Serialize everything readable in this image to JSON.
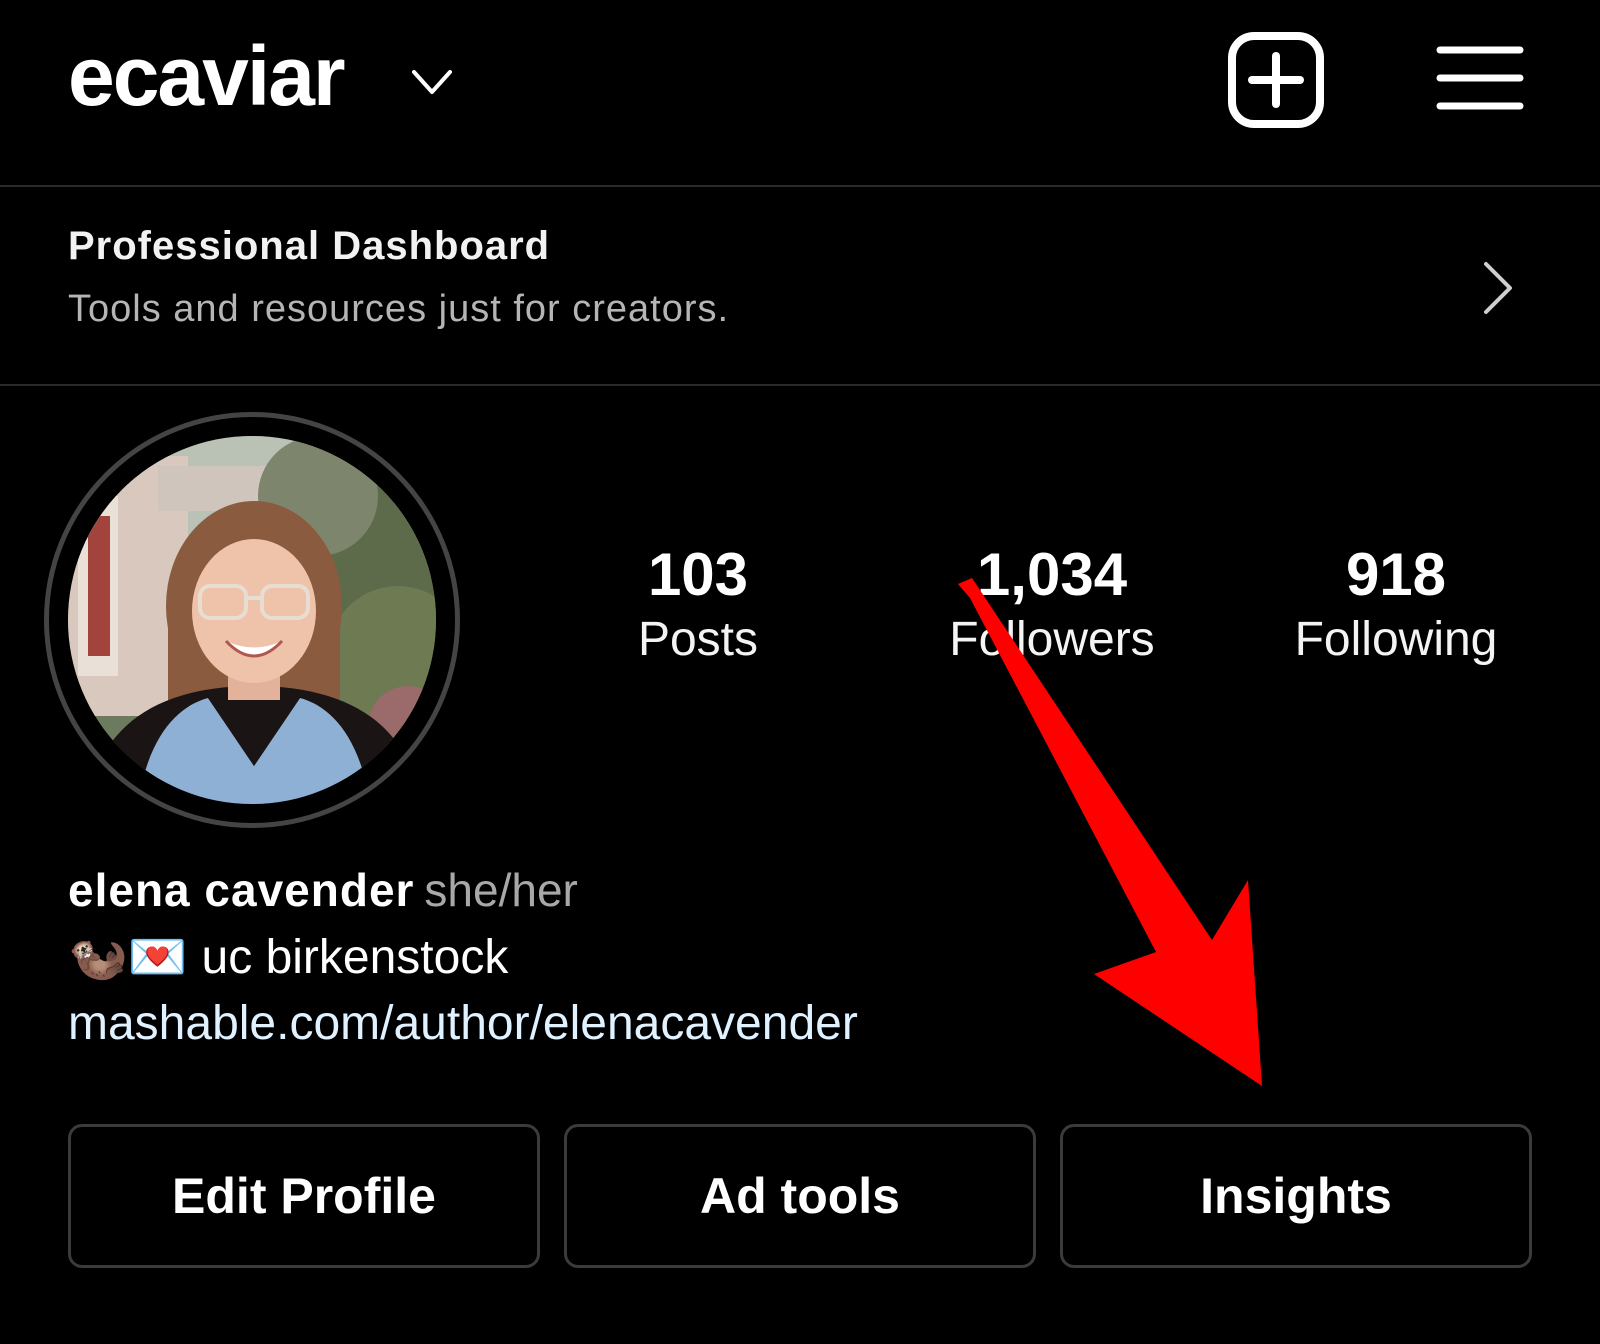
{
  "header": {
    "username": "ecaviar",
    "account_switch_icon": "chevron-down-icon",
    "add_icon": "plus-square-icon",
    "menu_icon": "hamburger-menu-icon"
  },
  "dashboard": {
    "title": "Professional Dashboard",
    "subtitle": "Tools and resources just for creators.",
    "icon": "chevron-right-icon"
  },
  "stats": [
    {
      "value": "103",
      "label": "Posts"
    },
    {
      "value": "1,034",
      "label": "Followers"
    },
    {
      "value": "918",
      "label": "Following"
    }
  ],
  "bio": {
    "name": "elena cavender",
    "pronouns": "she/her",
    "emoji": "🦦💌",
    "tagline": "uc birkenstock",
    "link": "mashable.com/author/elenacavender"
  },
  "buttons": {
    "edit_profile": "Edit Profile",
    "ad_tools": "Ad tools",
    "insights": "Insights"
  },
  "colors": {
    "background": "#000000",
    "divider": "#2a2a2a",
    "link": "#e0f1ff",
    "annotation_arrow": "#ff0000"
  }
}
